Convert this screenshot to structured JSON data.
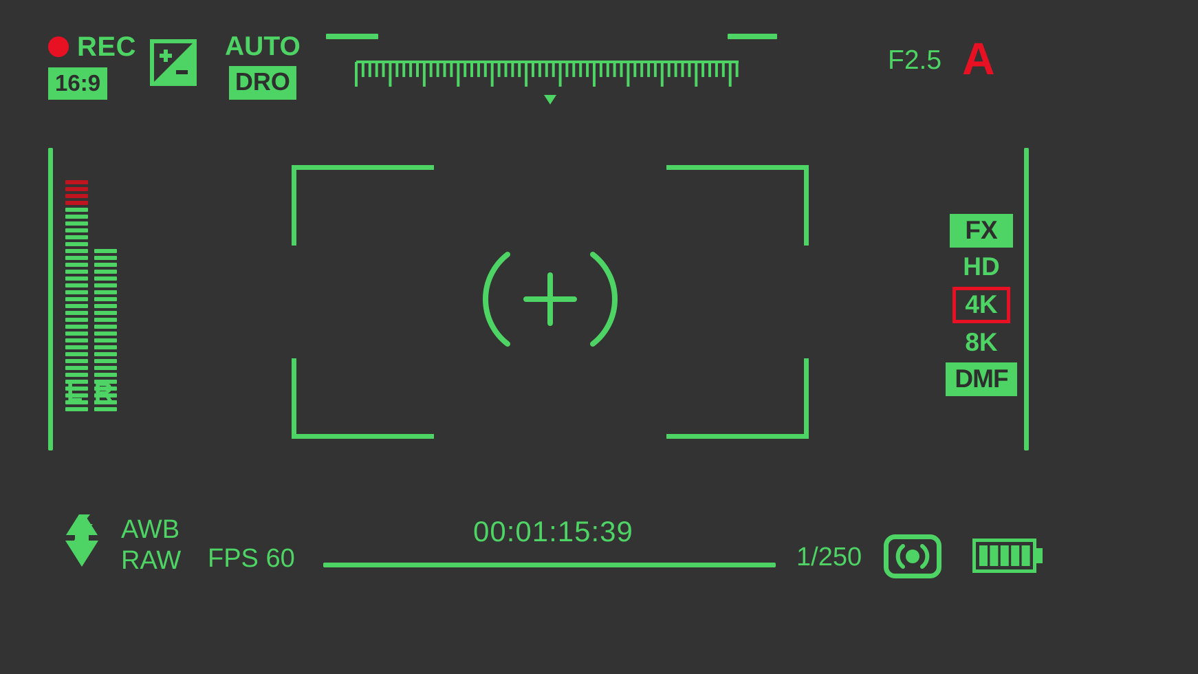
{
  "theme": {
    "background": "#333333",
    "accent_green": "#4ED464",
    "accent_red": "#E81123",
    "meter_red": "#C0141E",
    "chip_text": "#2E2E2E"
  },
  "top_left": {
    "rec_indicator": "REC",
    "rec_dot": "record-dot",
    "aspect_ratio": "16:9",
    "exposure_comp_icon": "exposure-compensation-icon",
    "exposure_plus": "+",
    "exposure_minus": "-",
    "auto_label": "AUTO",
    "dro_label": "DRO"
  },
  "ruler": {
    "ticks_total": 57,
    "major_every": 5,
    "pointer_position_index": 28,
    "dash_left": "ruler-dash-left",
    "dash_right": "ruler-dash-right"
  },
  "top_right": {
    "aperture": "F2.5",
    "mode": "A"
  },
  "audio": {
    "left_channel": {
      "label": "L",
      "total_segments": 34,
      "red_segments": 4
    },
    "right_channel": {
      "label": "R",
      "total_segments": 24,
      "red_segments": 0
    }
  },
  "center": {
    "reticle": "focus-reticle",
    "crosshair": "crosshair-plus",
    "brackets": [
      "top-left",
      "top-right",
      "bottom-left",
      "bottom-right"
    ]
  },
  "formats": [
    {
      "label": "FX",
      "style": "filled"
    },
    {
      "label": "HD",
      "style": "plain"
    },
    {
      "label": "4K",
      "style": "outlined"
    },
    {
      "label": "8K",
      "style": "plain"
    },
    {
      "label": "DMF",
      "style": "filled"
    }
  ],
  "bottom": {
    "flash_icon": "flash-bolt-icon",
    "white_balance": "AWB",
    "file_format": "RAW",
    "fps": "FPS 60",
    "timecode": "00:01:15:39",
    "shutter_speed": "1/250",
    "metering_icon": "metering-mode-icon",
    "battery_icon": "battery-icon",
    "battery_bars": 5
  }
}
